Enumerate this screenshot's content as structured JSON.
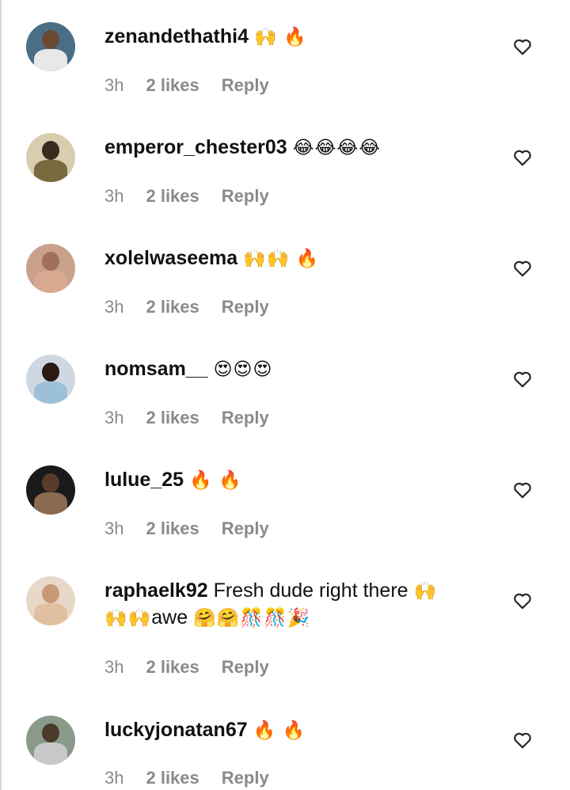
{
  "comments": [
    {
      "username": "zenandethathi4",
      "text": "",
      "emoji": "🙌 🔥",
      "time": "3h",
      "likes": "2 likes",
      "reply": "Reply",
      "avatar": {
        "bg": "#4a6e86",
        "head": "#6b4a35",
        "body": "#e8e8e8"
      }
    },
    {
      "username": "emperor_chester03",
      "text": "",
      "emoji": "😂😂😂😂",
      "time": "3h",
      "likes": "2 likes",
      "reply": "Reply",
      "avatar": {
        "bg": "#d9cdb0",
        "head": "#3a2a20",
        "body": "#7a6a40"
      }
    },
    {
      "username": "xolelwaseema",
      "text": "",
      "emoji": "🙌🙌 🔥",
      "time": "3h",
      "likes": "2 likes",
      "reply": "Reply",
      "avatar": {
        "bg": "#c9a08a",
        "head": "#a0705a",
        "body": "#d8a890"
      }
    },
    {
      "username": "nomsam__",
      "text": "",
      "emoji": "😍😍😍",
      "time": "3h",
      "likes": "2 likes",
      "reply": "Reply",
      "avatar": {
        "bg": "#cfd8e0",
        "head": "#2a1a14",
        "body": "#9cc0d8"
      }
    },
    {
      "username": "lulue_25",
      "text": "",
      "emoji": "🔥 🔥",
      "time": "3h",
      "likes": "2 likes",
      "reply": "Reply",
      "avatar": {
        "bg": "#1a1a1a",
        "head": "#5a3a2a",
        "body": "#8a6a50"
      }
    },
    {
      "username": "raphaelk92",
      "text": "Fresh dude right there",
      "emoji_after": "🙌",
      "line2_emoji_a": "🙌🙌",
      "line2_text": "awe",
      "line2_emoji_b": "🤗🤗🎊🎊🎉",
      "time": "3h",
      "likes": "2 likes",
      "reply": "Reply",
      "avatar": {
        "bg": "#e8d8c8",
        "head": "#c89878",
        "body": "#e0c0a0"
      }
    },
    {
      "username": "luckyjonatan67",
      "text": "",
      "emoji": "🔥 🔥",
      "time": "3h",
      "likes": "2 likes",
      "reply": "Reply",
      "avatar": {
        "bg": "#8a9a8a",
        "head": "#4a3a2a",
        "body": "#c8c8c8"
      }
    }
  ]
}
